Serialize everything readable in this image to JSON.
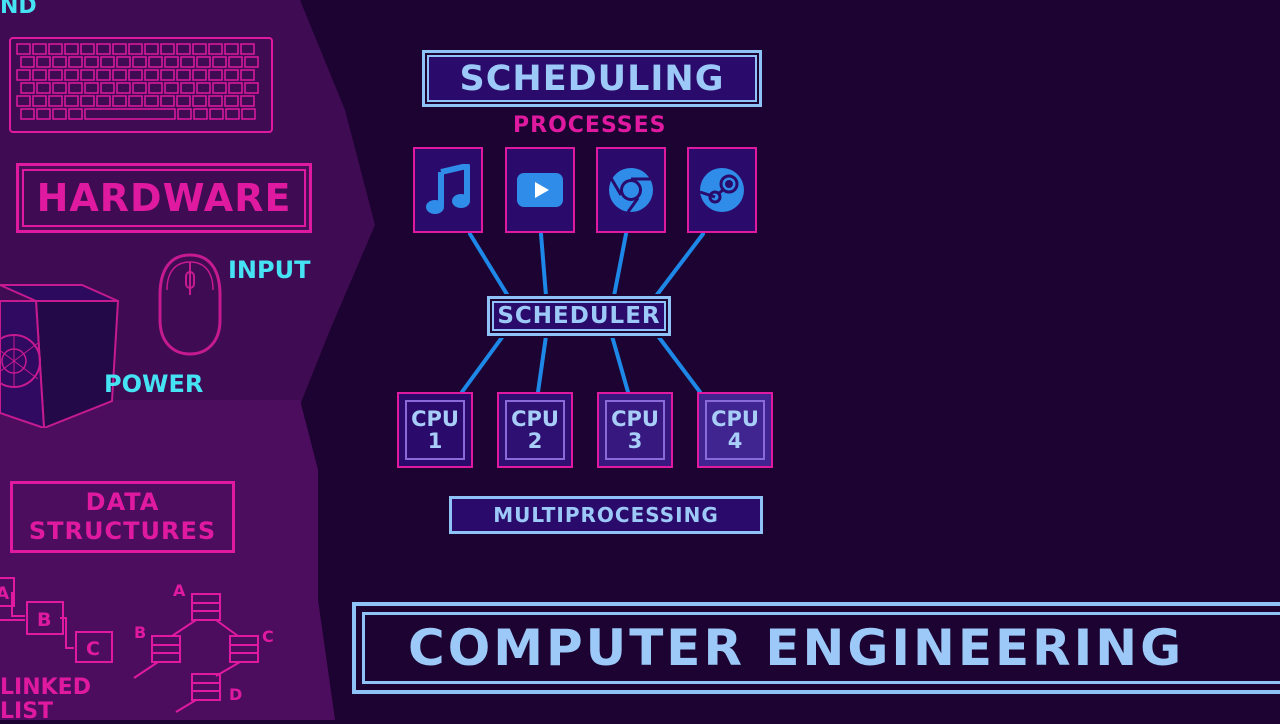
{
  "left_panel": {
    "cut_text_top": "ND",
    "hardware_label": "HARDWARE",
    "input_label": "INPUT",
    "power_label": "POWER",
    "data_structures_label": "DATA STRUCTURES",
    "linked_list_label": "LINKED LIST",
    "list_nodes": [
      "A",
      "B",
      "C"
    ],
    "tree_nodes": [
      "A",
      "B",
      "C",
      "D"
    ]
  },
  "diagram": {
    "title": "SCHEDULING",
    "processes_label": "PROCESSES",
    "process_icons": [
      "music-icon",
      "youtube-icon",
      "chrome-icon",
      "steam-icon"
    ],
    "scheduler_label": "SCHEDULER",
    "cpus": [
      {
        "label": "CPU",
        "num": "1"
      },
      {
        "label": "CPU",
        "num": "2"
      },
      {
        "label": "CPU",
        "num": "3"
      },
      {
        "label": "CPU",
        "num": "4"
      }
    ],
    "footer_label": "MULTIPROCESSING"
  },
  "banner": {
    "text": "COMPUTER ENGINEERING"
  },
  "colors": {
    "background": "#1c0331",
    "left_panel": "#4a0d58",
    "magenta": "#e01aa0",
    "light_blue": "#8fc3f7",
    "cyan": "#45e3f4",
    "line_blue": "#1e88e8",
    "box_fill": "#2a0a6a"
  }
}
